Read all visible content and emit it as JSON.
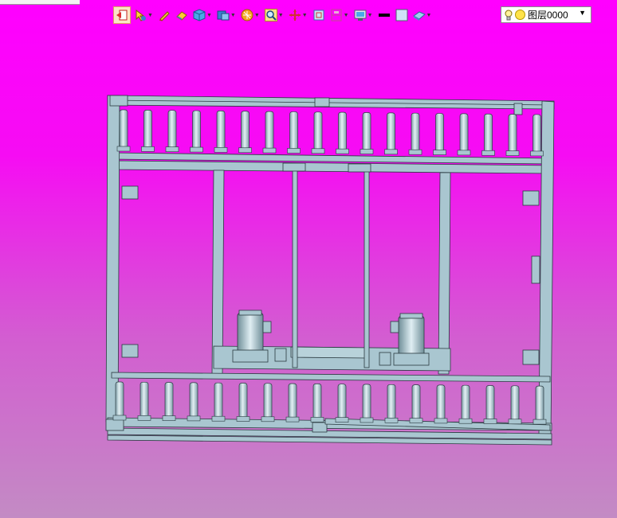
{
  "toolbar": {
    "buttons": [
      {
        "name": "exit-view-icon",
        "active": true,
        "dropdown": false
      },
      {
        "name": "pointer-tool-icon",
        "active": false,
        "dropdown": true
      },
      {
        "name": "pen-icon",
        "active": false,
        "dropdown": false
      },
      {
        "name": "eraser-icon",
        "active": false,
        "dropdown": false
      },
      {
        "name": "cube-icon",
        "active": false,
        "dropdown": true
      },
      {
        "name": "view-orientation-icon",
        "active": false,
        "dropdown": true
      },
      {
        "name": "render-icon",
        "active": false,
        "dropdown": true
      },
      {
        "name": "zoom-icon",
        "active": false,
        "dropdown": true
      },
      {
        "name": "pan-icon",
        "active": false,
        "dropdown": true
      },
      {
        "name": "zoom-window-icon",
        "active": false,
        "dropdown": false
      },
      {
        "name": "section-view-icon",
        "active": false,
        "dropdown": true
      },
      {
        "name": "display-style-icon",
        "active": false,
        "dropdown": true
      },
      {
        "name": "line-style-icon",
        "active": false,
        "dropdown": false
      },
      {
        "name": "fill-color-icon",
        "active": false,
        "dropdown": false
      },
      {
        "name": "material-icon",
        "active": false,
        "dropdown": true
      }
    ]
  },
  "layer": {
    "value": "图层0000",
    "bulb": "lightbulb-icon",
    "color": "#ffe34a"
  },
  "colors": {
    "background_top": "#ff00ff",
    "background_bottom": "#c38bc4",
    "model_fill": "#a9c6d0",
    "model_edge": "#2a3a40"
  }
}
